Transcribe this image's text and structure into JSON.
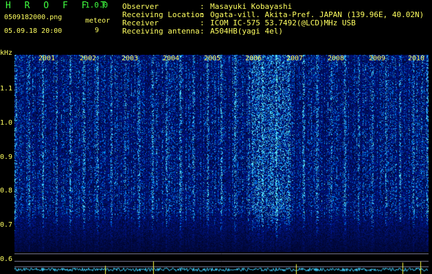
{
  "app": {
    "title": "H R O F F T",
    "version": "1.0.0",
    "filename": "0509182000.png",
    "datetime": "05.09.18 20:00",
    "meteor_label": "meteor",
    "meteor_count": "9"
  },
  "info": [
    {
      "label": "Observer",
      "value": "Masayuki Kobayashi"
    },
    {
      "label": "Receiving Location",
      "value": "Ogata-vill. Akita-Pref. JAPAN (139.96E, 40.02N)"
    },
    {
      "label": "Receiver",
      "value": "ICOM IC-575 53.7492(@LCD)MHz USB"
    },
    {
      "label": "Receiving antenna",
      "value": "A504HB(yagi 4el)"
    }
  ],
  "axis": {
    "unit": "kHz",
    "yticks": [
      "1.1",
      "1.0",
      "0.9",
      "0.8",
      "0.7",
      "0.6"
    ],
    "years": [
      "2001",
      "2002",
      "2003",
      "2004",
      "2005",
      "2006",
      "2007",
      "2008",
      "2009",
      "2010"
    ]
  },
  "colors": {
    "text": "#ffff60",
    "title": "#40ff40",
    "spectrogram_base": "#000c50",
    "noise": "#1e50ff",
    "waveform": "#40d0ff",
    "meteor_mark": "#ffff40"
  }
}
